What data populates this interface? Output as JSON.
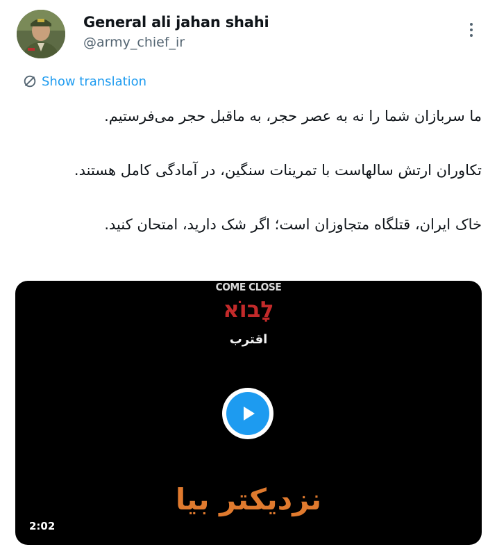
{
  "author": {
    "name": "General ali jahan shahi",
    "handle": "@army_chief_ir"
  },
  "translate_label": "Show translation",
  "tweet": {
    "lines": [
      "ما سربازان شما را نه به عصر حجر، به ماقبل حجر می‌فرستیم.",
      "تکاوران ارتش سالهاست با تمرینات سنگین، در آمادگی کامل هستند.",
      "خاک ایران، قتلگاه متجاوزان است؛ اگر شک دارید، امتحان کنید."
    ]
  },
  "video": {
    "overlay_english": "COME CLOSE",
    "overlay_hebrew": "לָבוֹא",
    "overlay_persian_small": "اقترب",
    "overlay_persian_big": "نزدیکتر بیا",
    "duration": "2:02"
  },
  "colors": {
    "accent": "#1d9bf0",
    "secondary_text": "#536471",
    "hebrew_red": "#c22a2a",
    "persian_orange": "#e07a2e"
  },
  "icons": [
    "translate-icon",
    "more-options-icon",
    "play-icon"
  ]
}
